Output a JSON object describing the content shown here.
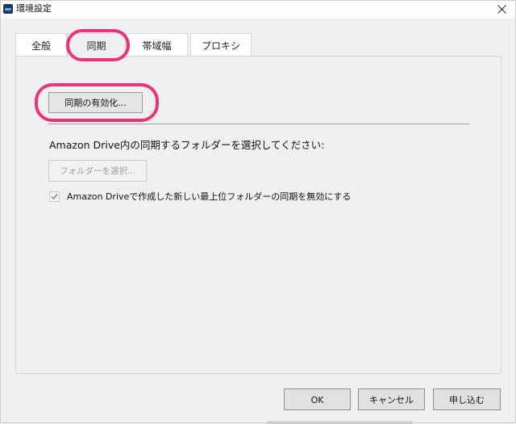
{
  "window": {
    "title": "環境設定",
    "close_icon": "close-icon",
    "app_icon": "amazon-drive-icon"
  },
  "tabs": [
    {
      "label": "全般",
      "selected": false
    },
    {
      "label": "同期",
      "selected": true
    },
    {
      "label": "帯域幅",
      "selected": false
    },
    {
      "label": "プロキシ",
      "selected": false
    }
  ],
  "sync": {
    "enable_button_label": "同期の有効化...",
    "select_prompt": "Amazon Drive内の同期するフォルダーを選択してください:",
    "select_folder_button_label": "フォルダーを選択...",
    "select_folder_enabled": false,
    "disable_new_folders_label": "Amazon Driveで作成した新しい最上位フォルダーの同期を無効にする",
    "disable_new_folders_checked": true,
    "disable_new_folders_enabled": false
  },
  "footer": {
    "ok_label": "OK",
    "cancel_label": "キャンセル",
    "apply_label": "申し込む"
  },
  "colors": {
    "highlight": "#e9337a",
    "dialog_background": "#f0f0f0"
  }
}
